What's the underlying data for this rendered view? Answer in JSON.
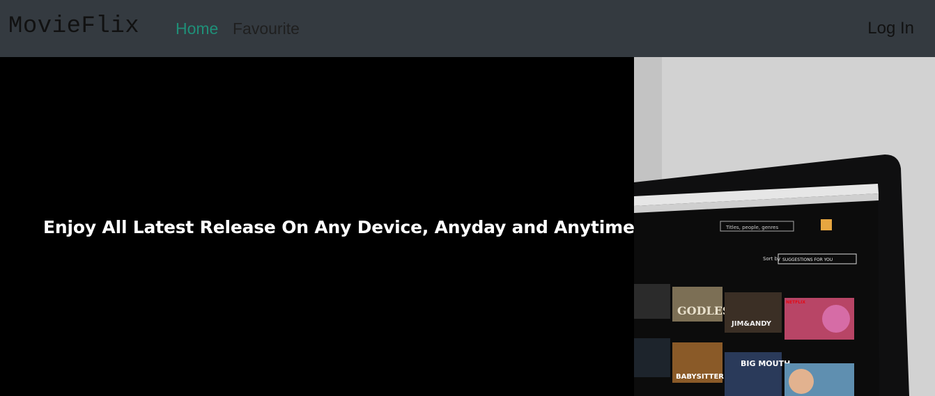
{
  "navbar": {
    "brand": "MovieFlix",
    "links": [
      {
        "label": "Home"
      },
      {
        "label": "Favourite"
      }
    ],
    "login_label": "Log In"
  },
  "hero": {
    "tagline": "Enjoy All Latest Release On Any Device, Anyday and Anytime"
  },
  "laptop_screen": {
    "search_placeholder": "Titles, people, genres",
    "sort_label": "Sort by",
    "sort_value": "SUGGESTIONS FOR YOU",
    "netflix_badge": "NETFLIX",
    "thumbnails": [
      {
        "title": "GODLESS"
      },
      {
        "title": "JIM&ANDY"
      },
      {
        "title": "BIG MOUTH"
      },
      {
        "title": "BABYSITTER"
      }
    ]
  },
  "colors": {
    "navbar_bg": "#343a40",
    "active_link": "#1f8f78",
    "hero_bg": "#000000"
  }
}
